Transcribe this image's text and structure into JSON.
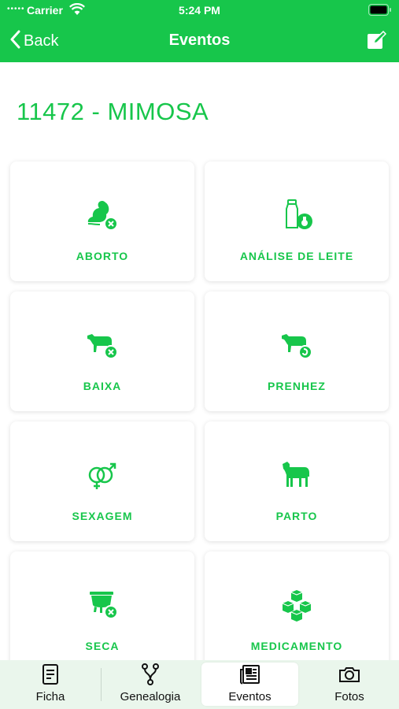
{
  "status_bar": {
    "carrier": "Carrier",
    "time": "5:24 PM"
  },
  "nav": {
    "back_label": "Back",
    "title": "Eventos"
  },
  "animal": {
    "title": "11472 - MIMOSA"
  },
  "events": [
    {
      "label": "ABORTO",
      "icon": "abortion-icon"
    },
    {
      "label": "ANÁLISE DE LEITE",
      "icon": "milk-analysis-icon"
    },
    {
      "label": "BAIXA",
      "icon": "cow-remove-icon"
    },
    {
      "label": "PRENHEZ",
      "icon": "pregnancy-icon"
    },
    {
      "label": "SEXAGEM",
      "icon": "gender-icon"
    },
    {
      "label": "PARTO",
      "icon": "calf-icon"
    },
    {
      "label": "SECA",
      "icon": "dry-off-icon"
    },
    {
      "label": "MEDICAMENTO",
      "icon": "medicine-boxes-icon"
    }
  ],
  "tabs": [
    {
      "label": "Ficha",
      "icon": "document-icon"
    },
    {
      "label": "Genealogia",
      "icon": "genealogy-icon"
    },
    {
      "label": "Eventos",
      "icon": "newspaper-icon",
      "active": true
    },
    {
      "label": "Fotos",
      "icon": "camera-icon"
    }
  ],
  "colors": {
    "brand": "#17c64b",
    "tabbar": "#eaf6ec"
  }
}
